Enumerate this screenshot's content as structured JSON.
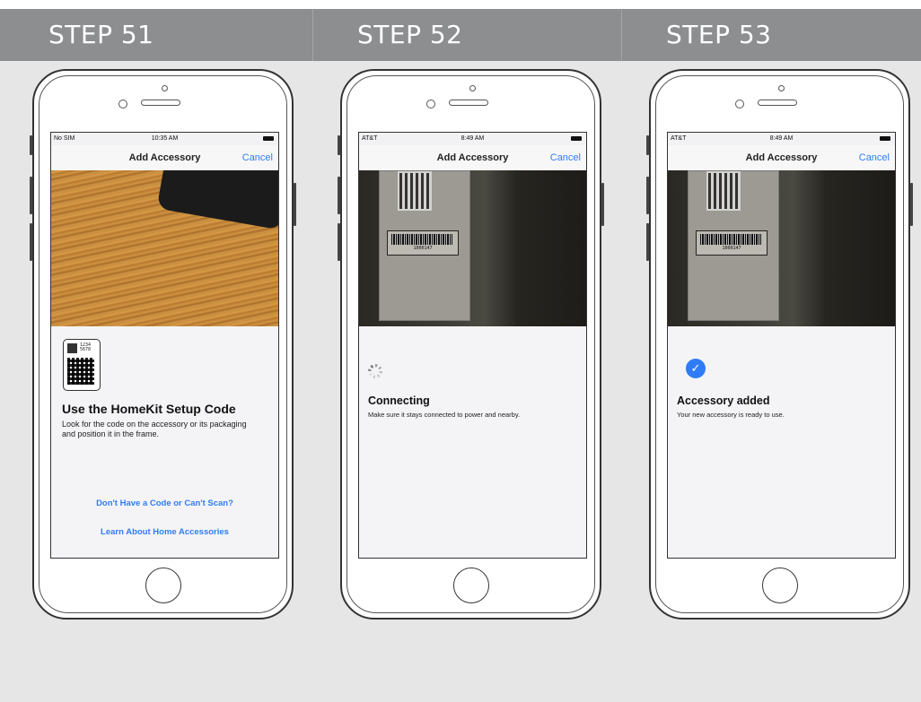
{
  "steps": [
    {
      "label": "STEP 51",
      "screen": {
        "carrier": "No SIM",
        "time": "10:35 AM",
        "nav_title": "Add Accessory",
        "cancel": "Cancel",
        "qr_digits": [
          "1234",
          "5678"
        ],
        "title": "Use the HomeKit Setup Code",
        "description": "Look for the code on the accessory or its packaging and position it in the frame.",
        "link_no_code": "Don't Have a Code or Can't Scan?",
        "link_learn": "Learn About Home Accessories"
      }
    },
    {
      "label": "STEP 52",
      "screen": {
        "carrier": "AT&T",
        "time": "8:49 AM",
        "nav_title": "Add Accessory",
        "cancel": "Cancel",
        "title": "Connecting",
        "description": "Make sure it stays connected to power and nearby."
      }
    },
    {
      "label": "STEP 53",
      "screen": {
        "carrier": "AT&T",
        "time": "8:49 AM",
        "nav_title": "Add Accessory",
        "cancel": "Cancel",
        "title": "Accessory added",
        "description": "Your new accessory is ready to use."
      }
    }
  ],
  "barcode_number": "1000147",
  "icons": {
    "spinner": "loading-spinner-icon",
    "check": "checkmark-circle-icon",
    "qr": "homekit-qr-code-icon",
    "battery": "battery-icon",
    "wifi": "wifi-icon"
  },
  "colors": {
    "header_band": "#8d8e90",
    "accent_blue": "#2f7cf6",
    "page_background": "#e6e6e7"
  }
}
